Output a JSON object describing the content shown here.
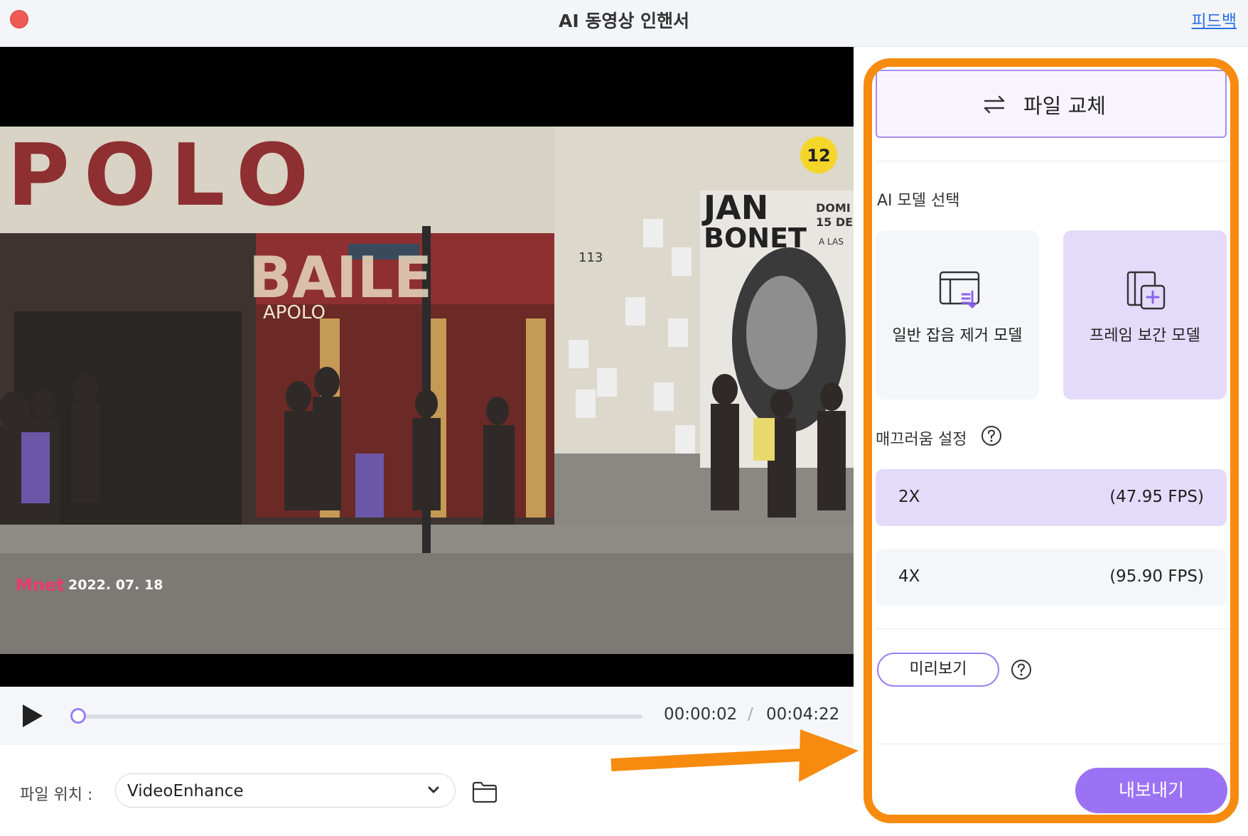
{
  "window": {
    "title": "AI 동영상 인핸서",
    "feedback": "피드백"
  },
  "video": {
    "overlay_texts": {
      "sign_main": "POLO",
      "sign_sub": "BAILE",
      "sign_small": "APOLO",
      "poster_name_1": "JAN",
      "poster_name_2": "BONET",
      "poster_date_1": "DOMI",
      "poster_date_2": "15 DE",
      "poster_date_3": "A LAS",
      "street_number": "113",
      "rating": "12",
      "broadcaster": "Mnet",
      "date": "2022. 07. 18"
    }
  },
  "player": {
    "current_time": "00:00:02",
    "separator": "/",
    "total_time": "00:04:22",
    "progress": 0.008
  },
  "file_location": {
    "label": "파일 위치 :",
    "value": "VideoEnhance"
  },
  "panel": {
    "replace_label": "파일 교체",
    "model_section_title": "AI 모델 선택",
    "models": [
      {
        "label": "일반 잡음 제거 모델",
        "selected": false
      },
      {
        "label": "프레임 보간 모델",
        "selected": true
      }
    ],
    "smooth_section_title": "매끄러움 설정",
    "fps_options": [
      {
        "multiplier": "2X",
        "fps": "(47.95 FPS)",
        "selected": true
      },
      {
        "multiplier": "4X",
        "fps": "(95.90 FPS)",
        "selected": false
      }
    ],
    "preview_label": "미리보기",
    "export_label": "내보내기"
  },
  "colors": {
    "accent": "#9a72f3",
    "accent_light": "#e4dbfb",
    "highlight": "#f68b0f",
    "link": "#2b6fe3"
  },
  "icons": [
    "close-dot-icon",
    "swap-arrows-icon",
    "denoise-model-icon",
    "frame-interpolation-icon",
    "help-icon",
    "play-icon",
    "chevron-down-icon",
    "folder-icon"
  ]
}
